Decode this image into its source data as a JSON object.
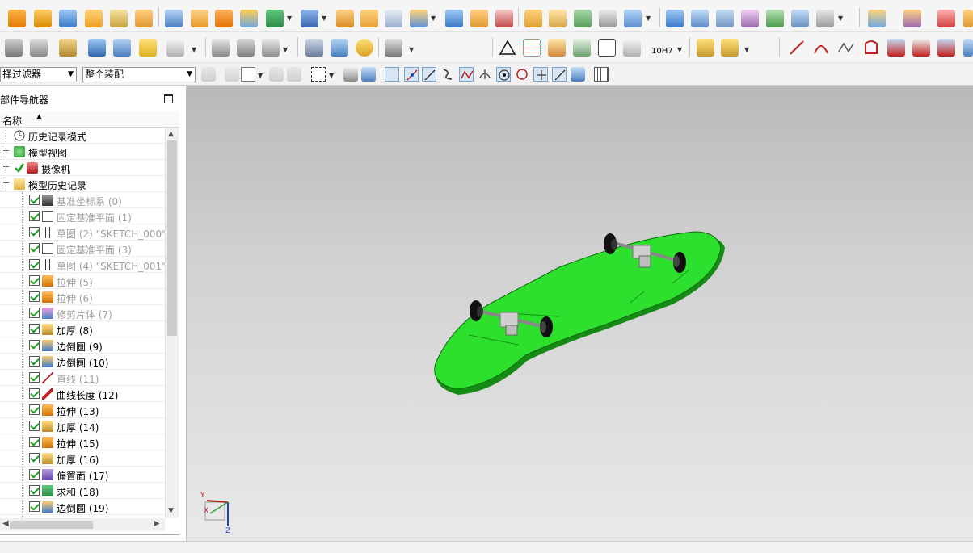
{
  "toolbar": {
    "filter_select": "择过滤器",
    "assembly_select": "整个装配",
    "tolerance_label": "10H7"
  },
  "part_navigator": {
    "title": "部件导航器",
    "column_name": "名称",
    "nodes": [
      {
        "label": "历史记录模式",
        "icon": "clock-icon",
        "dim": false
      },
      {
        "label": "模型视图",
        "icon": "model-view-icon",
        "dim": false
      },
      {
        "label": "摄像机",
        "icon": "camera-icon",
        "dim": false
      },
      {
        "label": "模型历史记录",
        "icon": "folder-open-icon",
        "dim": false
      }
    ],
    "features": [
      {
        "label": "基准坐标系 (0)",
        "icon": "datum-csys-icon",
        "dim": true
      },
      {
        "label": "固定基准平面 (1)",
        "icon": "datum-plane-icon",
        "dim": true
      },
      {
        "label": "草图 (2) \"SKETCH_000\"",
        "icon": "sketch-icon",
        "dim": true
      },
      {
        "label": "固定基准平面 (3)",
        "icon": "datum-plane-icon",
        "dim": true
      },
      {
        "label": "草图 (4) \"SKETCH_001\"",
        "icon": "sketch-icon",
        "dim": true
      },
      {
        "label": "拉伸 (5)",
        "icon": "extrude-icon",
        "dim": true
      },
      {
        "label": "拉伸 (6)",
        "icon": "extrude-icon",
        "dim": true
      },
      {
        "label": "修剪片体 (7)",
        "icon": "trim-sheet-icon",
        "dim": true
      },
      {
        "label": "加厚 (8)",
        "icon": "thicken-icon",
        "dim": false
      },
      {
        "label": "边倒圆 (9)",
        "icon": "edge-blend-icon",
        "dim": false
      },
      {
        "label": "边倒圆 (10)",
        "icon": "edge-blend-icon",
        "dim": false
      },
      {
        "label": "直线 (11)",
        "icon": "line-icon",
        "dim": true
      },
      {
        "label": "曲线长度 (12)",
        "icon": "curve-length-icon",
        "dim": false
      },
      {
        "label": "拉伸 (13)",
        "icon": "extrude-icon",
        "dim": false
      },
      {
        "label": "加厚 (14)",
        "icon": "thicken-icon",
        "dim": false
      },
      {
        "label": "拉伸 (15)",
        "icon": "extrude-icon",
        "dim": false
      },
      {
        "label": "加厚 (16)",
        "icon": "thicken-icon",
        "dim": false
      },
      {
        "label": "偏置面 (17)",
        "icon": "offset-face-icon",
        "dim": false
      },
      {
        "label": "求和 (18)",
        "icon": "unite-icon",
        "dim": false
      },
      {
        "label": "边倒圆 (19)",
        "icon": "edge-blend-icon",
        "dim": false
      }
    ]
  },
  "viewport": {
    "model": "skateboard",
    "deck_color": "#22cc22",
    "triad_labels": {
      "x": "X",
      "y": "Y",
      "z": "Z"
    }
  }
}
